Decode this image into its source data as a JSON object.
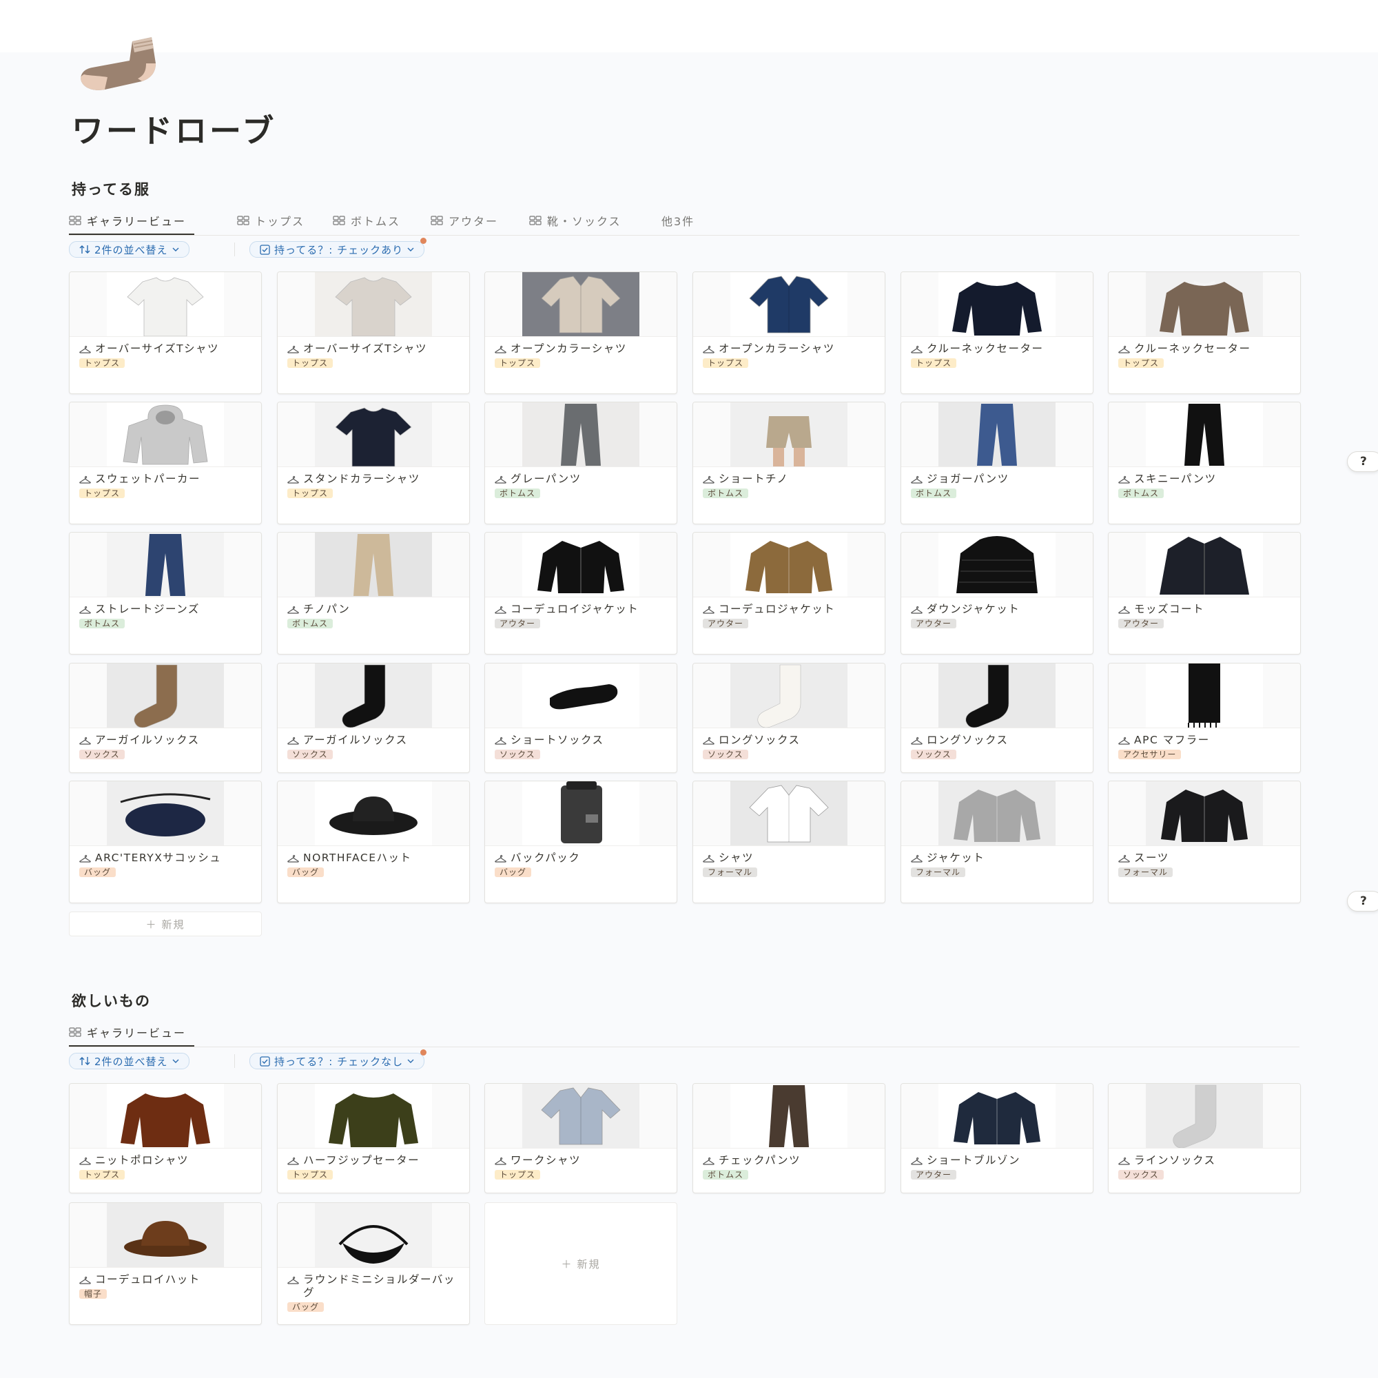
{
  "page": {
    "title": "ワードローブ"
  },
  "colors": {
    "tops": "#fdecc8",
    "bottoms": "#dbeddb",
    "outer": "#e3e2e0",
    "socks": "#f4dfd8",
    "accessory": "#fadec9",
    "bag": "#fadec9",
    "formal": "#e3e2e0",
    "hat": "#fadec9",
    "accent": "#2b6cb0"
  },
  "owned": {
    "section_title": "持ってる服",
    "tabs": [
      {
        "label": "ギャラリービュー",
        "icon": "gallery-icon"
      },
      {
        "label": "トップス",
        "icon": "gallery-icon"
      },
      {
        "label": "ボトムス",
        "icon": "gallery-icon"
      },
      {
        "label": "アウター",
        "icon": "gallery-icon"
      },
      {
        "label": "靴・ソックス",
        "icon": "gallery-icon"
      },
      {
        "label": "他3件"
      }
    ],
    "sort_label": "2件の並べ替え",
    "filter_label": "持ってる？: チェックあり",
    "new_label": "新規",
    "items": [
      {
        "name": "オーバーサイズTシャツ",
        "tag": "トップス",
        "tag_color": "#fdecc8"
      },
      {
        "name": "オーバーサイズTシャツ",
        "tag": "トップス",
        "tag_color": "#fdecc8"
      },
      {
        "name": "オープンカラーシャツ",
        "tag": "トップス",
        "tag_color": "#fdecc8"
      },
      {
        "name": "オープンカラーシャツ",
        "tag": "トップス",
        "tag_color": "#fdecc8"
      },
      {
        "name": "クルーネックセーター",
        "tag": "トップス",
        "tag_color": "#fdecc8"
      },
      {
        "name": "クルーネックセーター",
        "tag": "トップス",
        "tag_color": "#fdecc8"
      },
      {
        "name": "スウェットパーカー",
        "tag": "トップス",
        "tag_color": "#fdecc8"
      },
      {
        "name": "スタンドカラーシャツ",
        "tag": "トップス",
        "tag_color": "#fdecc8"
      },
      {
        "name": "グレーパンツ",
        "tag": "ボトムス",
        "tag_color": "#dbeddb"
      },
      {
        "name": "ショートチノ",
        "tag": "ボトムス",
        "tag_color": "#dbeddb"
      },
      {
        "name": "ジョガーパンツ",
        "tag": "ボトムス",
        "tag_color": "#dbeddb"
      },
      {
        "name": "スキニーパンツ",
        "tag": "ボトムス",
        "tag_color": "#dbeddb"
      },
      {
        "name": "ストレートジーンズ",
        "tag": "ボトムス",
        "tag_color": "#dbeddb"
      },
      {
        "name": "チノパン",
        "tag": "ボトムス",
        "tag_color": "#dbeddb"
      },
      {
        "name": "コーデュロイジャケット",
        "tag": "アウター",
        "tag_color": "#e3e2e0"
      },
      {
        "name": "コーデュロジャケット",
        "tag": "アウター",
        "tag_color": "#e3e2e0"
      },
      {
        "name": "ダウンジャケット",
        "tag": "アウター",
        "tag_color": "#e3e2e0"
      },
      {
        "name": "モッズコート",
        "tag": "アウター",
        "tag_color": "#e3e2e0"
      },
      {
        "name": "アーガイルソックス",
        "tag": "ソックス",
        "tag_color": "#f4dfd8"
      },
      {
        "name": "アーガイルソックス",
        "tag": "ソックス",
        "tag_color": "#f4dfd8"
      },
      {
        "name": "ショートソックス",
        "tag": "ソックス",
        "tag_color": "#f4dfd8"
      },
      {
        "name": "ロングソックス",
        "tag": "ソックス",
        "tag_color": "#f4dfd8"
      },
      {
        "name": "ロングソックス",
        "tag": "ソックス",
        "tag_color": "#f4dfd8"
      },
      {
        "name": "APC マフラー",
        "tag": "アクセサリー",
        "tag_color": "#fadec9"
      },
      {
        "name": "ARC'TERYXサコッシュ",
        "tag": "バッグ",
        "tag_color": "#fadec9"
      },
      {
        "name": "NORTHFACEハット",
        "tag": "バッグ",
        "tag_color": "#fadec9"
      },
      {
        "name": "バックパック",
        "tag": "バッグ",
        "tag_color": "#fadec9"
      },
      {
        "name": "シャツ",
        "tag": "フォーマル",
        "tag_color": "#e3e2e0"
      },
      {
        "name": "ジャケット",
        "tag": "フォーマル",
        "tag_color": "#e3e2e0"
      },
      {
        "name": "スーツ",
        "tag": "フォーマル",
        "tag_color": "#e3e2e0"
      }
    ]
  },
  "wanted": {
    "section_title": "欲しいもの",
    "tabs": [
      {
        "label": "ギャラリービュー",
        "icon": "gallery-icon"
      }
    ],
    "sort_label": "2件の並べ替え",
    "filter_label": "持ってる？: チェックなし",
    "new_label": "新規",
    "items": [
      {
        "name": "ニットポロシャツ",
        "tag": "トップス",
        "tag_color": "#fdecc8"
      },
      {
        "name": "ハーフジップセーター",
        "tag": "トップス",
        "tag_color": "#fdecc8"
      },
      {
        "name": "ワークシャツ",
        "tag": "トップス",
        "tag_color": "#fdecc8"
      },
      {
        "name": "チェックパンツ",
        "tag": "ボトムス",
        "tag_color": "#dbeddb"
      },
      {
        "name": "ショートブルゾン",
        "tag": "アウター",
        "tag_color": "#e3e2e0"
      },
      {
        "name": "ラインソックス",
        "tag": "ソックス",
        "tag_color": "#f4dfd8"
      },
      {
        "name": "コーデュロイハット",
        "tag": "帽子",
        "tag_color": "#fadec9"
      },
      {
        "name": "ラウンドミニショルダーバッグ",
        "tag": "バッグ",
        "tag_color": "#fadec9"
      }
    ]
  },
  "help_label": "?"
}
